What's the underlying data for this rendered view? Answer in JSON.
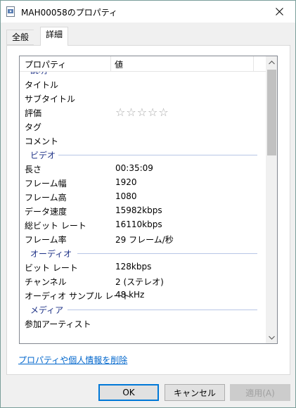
{
  "window": {
    "title": "MAH00058のプロパティ"
  },
  "tabs": [
    {
      "label": "全般"
    },
    {
      "label": "詳細"
    }
  ],
  "list": {
    "header": {
      "name": "プロパティ",
      "value": "値"
    },
    "groups": {
      "description": "説明",
      "video": "ビデオ",
      "audio": "オーディオ",
      "media": "メディア"
    },
    "description_rows": [
      {
        "name": "タイトル",
        "value": ""
      },
      {
        "name": "サブタイトル",
        "value": ""
      },
      {
        "name": "評価",
        "value": "☆☆☆☆☆"
      },
      {
        "name": "タグ",
        "value": ""
      },
      {
        "name": "コメント",
        "value": ""
      }
    ],
    "video_rows": [
      {
        "name": "長さ",
        "value": "00:35:09"
      },
      {
        "name": "フレーム幅",
        "value": "1920"
      },
      {
        "name": "フレーム高",
        "value": "1080"
      },
      {
        "name": "データ速度",
        "value": "15982kbps"
      },
      {
        "name": "総ビット レート",
        "value": "16110kbps"
      },
      {
        "name": "フレーム率",
        "value": "29 フレーム/秒"
      }
    ],
    "audio_rows": [
      {
        "name": "ビット レート",
        "value": "128kbps"
      },
      {
        "name": "チャンネル",
        "value": "2 (ステレオ)"
      },
      {
        "name": "オーディオ サンプル レート",
        "value": "48 kHz"
      }
    ],
    "media_rows": [
      {
        "name": "参加アーティスト",
        "value": ""
      }
    ]
  },
  "remove_link": "プロパティや個人情報を削除",
  "buttons": {
    "ok": "OK",
    "cancel": "キャンセル",
    "apply": "適用(A)"
  }
}
